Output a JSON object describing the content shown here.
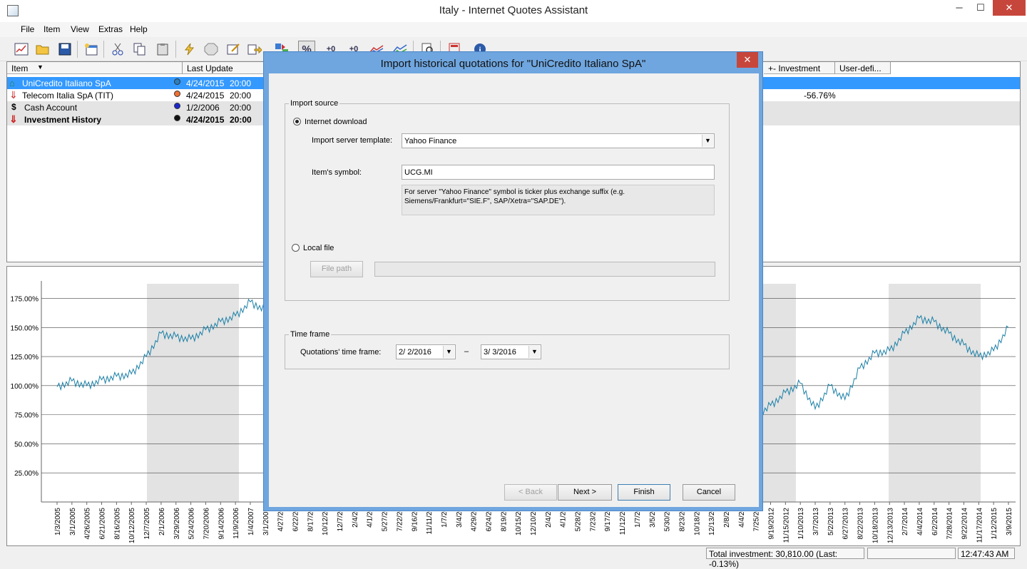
{
  "window": {
    "title": "Italy - Internet Quotes Assistant",
    "minimize": "─",
    "maximize": "☐",
    "close": "✕"
  },
  "menu": [
    "File",
    "Item",
    "View",
    "Extras",
    "Help"
  ],
  "toolbar": {
    "percent_btn": "%",
    "plus_btn": "+0",
    "minus_btn": "+0",
    "info": "i"
  },
  "grid": {
    "headers": {
      "item": "Item",
      "last_update": "Last Update",
      "investment": "+- Investment",
      "user_defined": "User-defi..."
    },
    "rows": [
      {
        "name": "UniCredito Italiano SpA",
        "date": "4/24/2015",
        "time": "20:00",
        "investment": "",
        "dot_color": "#2a7fbf",
        "selected": true
      },
      {
        "name": "Telecom Italia SpA (TIT)",
        "date": "4/24/2015",
        "time": "20:00",
        "investment": "-56.76%",
        "dot_color": "#f07030",
        "selected": false
      },
      {
        "name": "Cash Account",
        "date": "1/2/2006",
        "time": "20:00",
        "investment": "",
        "dot_color": "#1a28d0",
        "selected": false
      },
      {
        "name": "Investment History",
        "date": "4/24/2015",
        "time": "20:00",
        "investment": "",
        "dot_color": "#111111",
        "selected": false,
        "bold": true
      }
    ]
  },
  "chart_data": {
    "type": "line",
    "y_ticks": [
      "175.00%",
      "150.00%",
      "125.00%",
      "100.00%",
      "75.00%",
      "50.00%",
      "25.00%"
    ],
    "x_ticks_left": [
      "1/3/2005",
      "3/1/2005",
      "4/26/2005",
      "6/21/2005",
      "8/16/2005",
      "10/12/2005",
      "12/7/2005",
      "2/1/2006",
      "3/29/2006",
      "5/24/2006",
      "7/20/2006",
      "9/14/2006",
      "11/9/2006",
      "1/4/2007",
      "3/1/2007",
      "4/27/20"
    ],
    "x_ticks_right": [
      "7/25/20",
      "9/19/2012",
      "11/15/2012",
      "1/10/2013",
      "3/7/2013",
      "5/2/2013",
      "6/27/2013",
      "8/22/2013",
      "10/18/2013",
      "12/13/2013",
      "2/7/2014",
      "4/4/2014",
      "6/2/2014",
      "7/28/2014",
      "9/22/2014",
      "11/17/2014",
      "1/12/2015",
      "3/9/2015"
    ],
    "x_ticks_hidden": [
      "6/22/20",
      "8/17/20",
      "10/12/20",
      "12/7/20",
      "2/4/20",
      "4/1/20",
      "5/27/20",
      "7/22/20",
      "9/16/20",
      "11/11/20",
      "1/7/20",
      "3/4/20",
      "4/29/20",
      "6/24/20",
      "8/19/20",
      "10/15/20",
      "12/10/20",
      "2/4/20",
      "4/1/20",
      "5/28/20",
      "7/23/20",
      "9/17/20",
      "11/12/20",
      "1/7/20",
      "3/5/20",
      "5/30/20",
      "8/23/20",
      "10/18/20",
      "12/13/20",
      "2/8/20",
      "4/4/20"
    ],
    "series_left": [
      {
        "x": "1/3/2005",
        "y": 99
      },
      {
        "x": "3/1/2005",
        "y": 104
      },
      {
        "x": "4/26/2005",
        "y": 100
      },
      {
        "x": "6/21/2005",
        "y": 105
      },
      {
        "x": "8/16/2005",
        "y": 108
      },
      {
        "x": "10/12/2005",
        "y": 110
      },
      {
        "x": "12/7/2005",
        "y": 125
      },
      {
        "x": "2/1/2006",
        "y": 145
      },
      {
        "x": "3/29/2006",
        "y": 142
      },
      {
        "x": "5/24/2006",
        "y": 140
      },
      {
        "x": "7/20/2006",
        "y": 148
      },
      {
        "x": "9/14/2006",
        "y": 155
      },
      {
        "x": "11/9/2006",
        "y": 160
      },
      {
        "x": "1/4/2007",
        "y": 172
      },
      {
        "x": "3/1/2007",
        "y": 165
      }
    ],
    "series_right": [
      {
        "x": "7/25/20",
        "y": 74
      },
      {
        "x": "9/19/2012",
        "y": 83
      },
      {
        "x": "11/15/2012",
        "y": 94
      },
      {
        "x": "1/10/2013",
        "y": 102
      },
      {
        "x": "3/7/2013",
        "y": 80
      },
      {
        "x": "5/2/2013",
        "y": 100
      },
      {
        "x": "6/27/2013",
        "y": 88
      },
      {
        "x": "8/22/2013",
        "y": 115
      },
      {
        "x": "10/18/2013",
        "y": 128
      },
      {
        "x": "12/13/2013",
        "y": 130
      },
      {
        "x": "2/7/2014",
        "y": 145
      },
      {
        "x": "4/4/2014",
        "y": 158
      },
      {
        "x": "6/2/2014",
        "y": 155
      },
      {
        "x": "7/28/2014",
        "y": 145
      },
      {
        "x": "9/22/2014",
        "y": 135
      },
      {
        "x": "11/17/2014",
        "y": 125
      },
      {
        "x": "1/12/2015",
        "y": 130
      },
      {
        "x": "3/9/2015",
        "y": 150
      }
    ],
    "ylim": [
      0,
      190
    ],
    "line_color": "#1a7fa6",
    "grid": true
  },
  "dialog": {
    "title": "Import historical quotations for \"UniCredito Italiano SpA\"",
    "close": "✕",
    "import_source": "Import source",
    "internet_download": "Internet download",
    "server_template_label": "Import server template:",
    "server_template_value": "Yahoo Finance",
    "symbol_label": "Item's symbol:",
    "symbol_value": "UCG.MI",
    "hint_line1": "For server \"Yahoo Finance\" symbol is ticker plus exchange suffix (e.g.",
    "hint_line2": "Siemens/Frankfurt=\"SIE.F\", SAP/Xetra=\"SAP.DE\").",
    "local_file": "Local file",
    "file_path_btn": "File path",
    "time_frame": "Time frame",
    "time_frame_label": "Quotations' time frame:",
    "date_from": "2/  2/2016",
    "date_sep": "–",
    "date_to": "3/  3/2016",
    "back": "< Back",
    "next": "Next >",
    "finish": "Finish",
    "cancel": "Cancel"
  },
  "status": {
    "total": "Total investment: 30,810.00 (Last: -0.13%)",
    "time": "12:47:43 AM"
  }
}
